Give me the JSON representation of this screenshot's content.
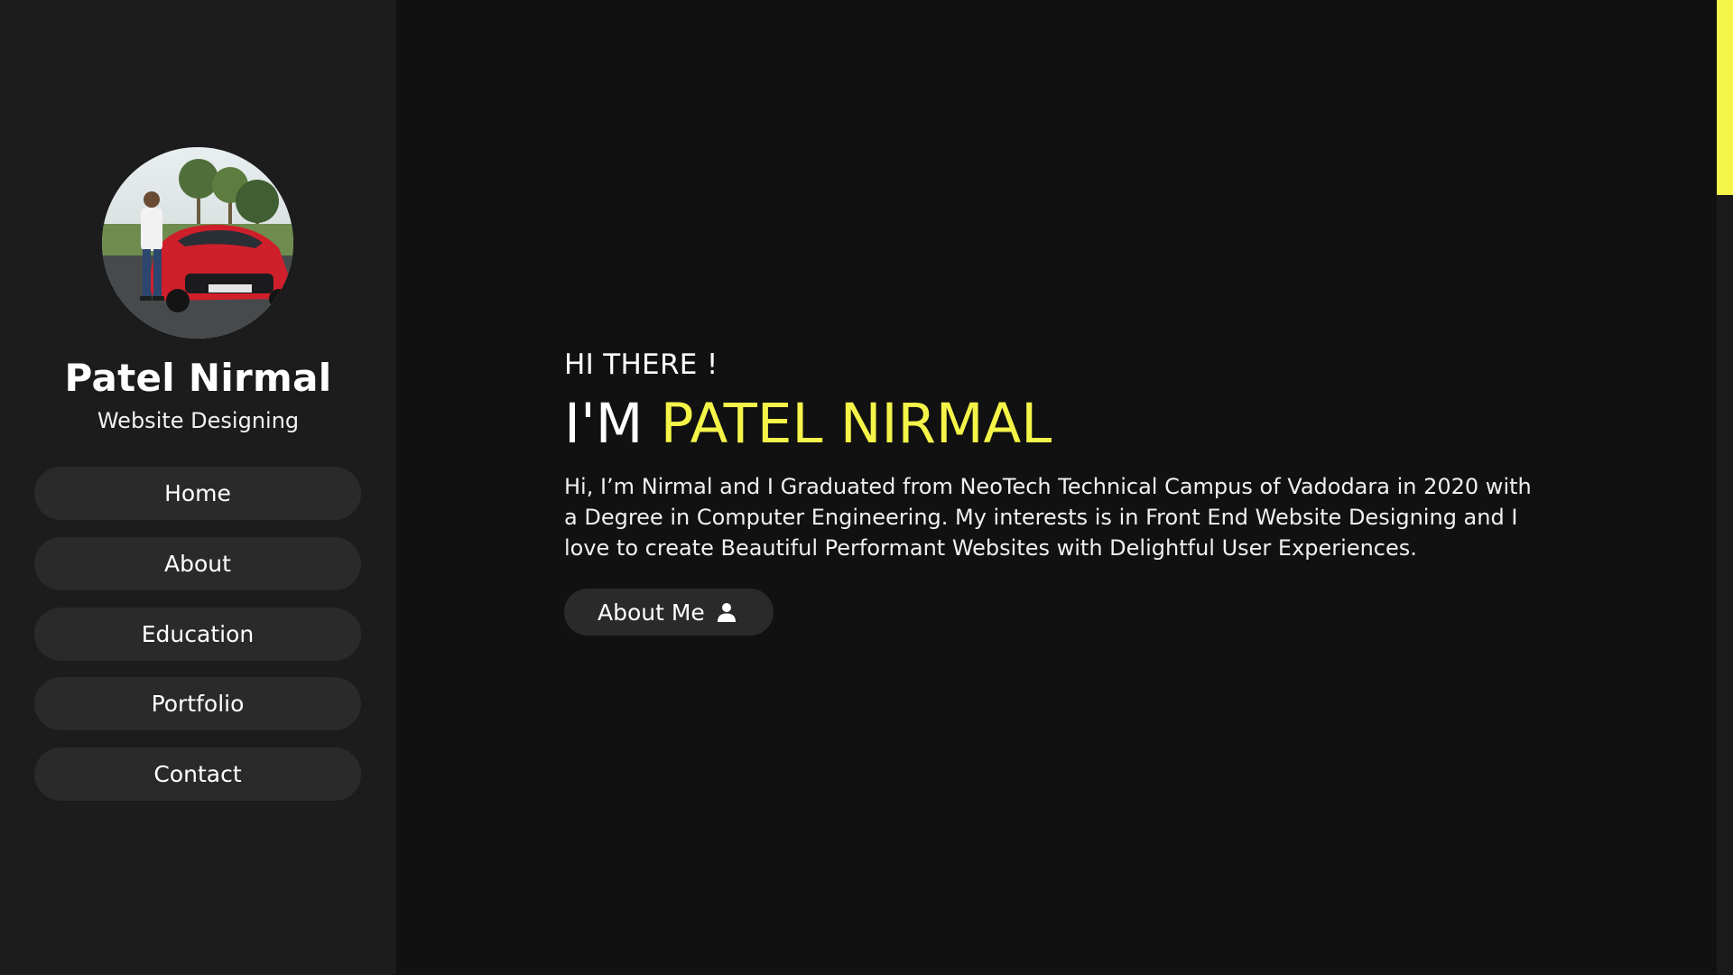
{
  "profile": {
    "name": "Patel Nirmal",
    "role": "Website Designing"
  },
  "nav": [
    {
      "label": "Home"
    },
    {
      "label": "About"
    },
    {
      "label": "Education"
    },
    {
      "label": "Portfolio"
    },
    {
      "label": "Contact"
    }
  ],
  "hero": {
    "greeting": "HI THERE !",
    "headline_prefix": "I'M ",
    "headline_name": "PATEL NIRMAL",
    "intro": "Hi, I’m Nirmal and I Graduated from NeoTech Technical Campus of Vadodara in 2020 with a Degree in Computer Engineering. My interests is in Front End Website Designing and I love to create Beautiful Performant Websites with Delightful User Experiences.",
    "button_label": "About Me",
    "button_icon": "user-icon"
  },
  "colors": {
    "background": "#111111",
    "sidebar": "#1c1c1c",
    "button": "#2a2a2a",
    "accent": "#f4f449",
    "text": "#ffffff"
  }
}
